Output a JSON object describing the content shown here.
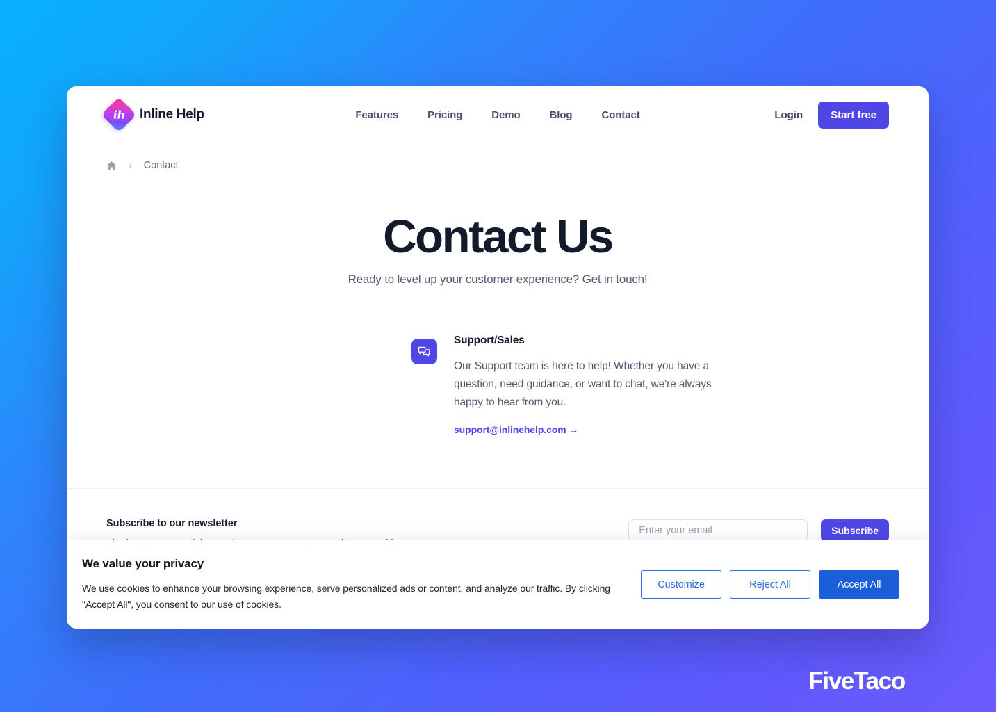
{
  "brand": {
    "name": "Inline Help",
    "mark_text": "ih",
    "mark_icon": "diamond-logo-icon"
  },
  "nav": {
    "items": [
      {
        "label": "Features"
      },
      {
        "label": "Pricing"
      },
      {
        "label": "Demo"
      },
      {
        "label": "Blog"
      },
      {
        "label": "Contact"
      }
    ],
    "login_label": "Login",
    "cta_label": "Start free"
  },
  "breadcrumb": {
    "home_icon": "home-icon",
    "separator": "›",
    "current": "Contact"
  },
  "hero": {
    "title": "Contact Us",
    "subtitle": "Ready to level up your customer experience? Get in touch!"
  },
  "contact": {
    "icon": "chat-bubbles-icon",
    "title": "Support/Sales",
    "description": "Our Support team is here to help! Whether you have a question, need guidance, or want to chat, we're always happy to hear from you.",
    "link_label": "support@inlinehelp.com →"
  },
  "newsletter": {
    "title": "Subscribe to our newsletter",
    "description": "The latest news, articles, and resources, sent to your inbox weekly.",
    "placeholder": "Enter your email",
    "value": "",
    "submit_label": "Subscribe"
  },
  "cookies": {
    "title": "We value your privacy",
    "body": "We use cookies to enhance your browsing experience, serve personalized ads or content, and analyze our traffic. By clicking \"Accept All\", you consent to our use of cookies.",
    "customize_label": "Customize",
    "reject_label": "Reject All",
    "accept_label": "Accept All"
  },
  "help_widget": {
    "icon": "question-chat-icon"
  },
  "watermark": {
    "text": "FiveTaco"
  },
  "colors": {
    "accent": "#5046e5",
    "cookie_primary": "#1a5fd9",
    "cookie_outline": "#2f6fe0",
    "help_widget": "#6b21c4",
    "heading": "#121a2c",
    "bg_start": "#08b0fd",
    "bg_end": "#6a5bfd"
  }
}
